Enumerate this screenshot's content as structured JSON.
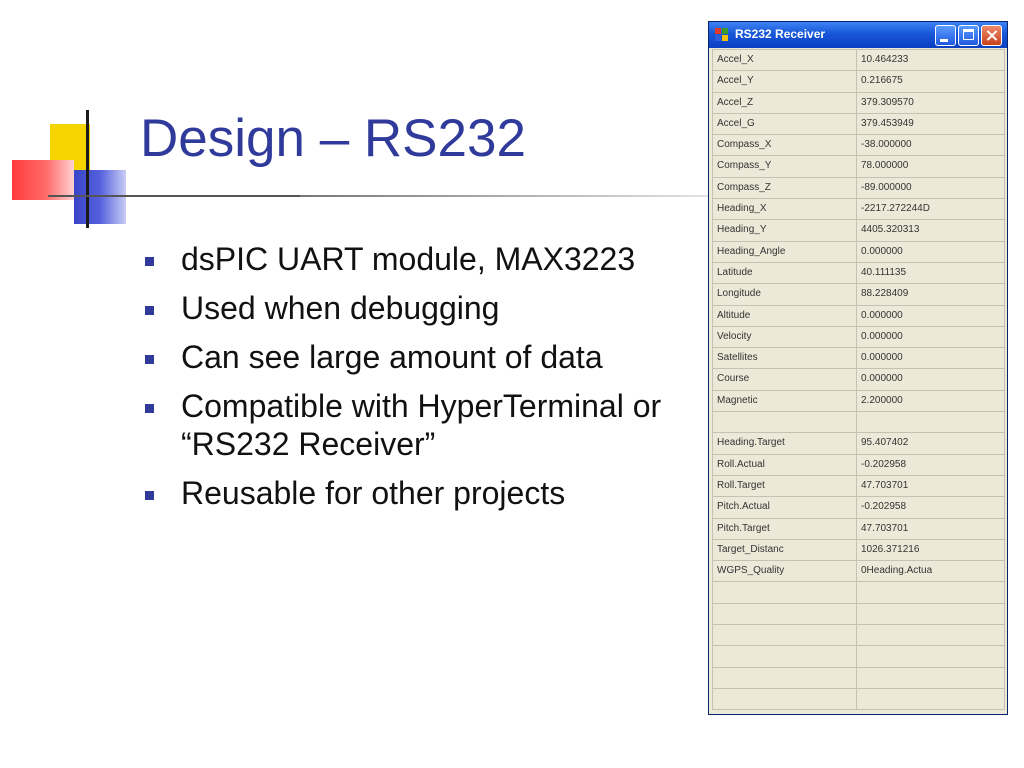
{
  "slide": {
    "title": "Design – RS232",
    "bullets": [
      "dsPIC UART module, MAX3223",
      "Used when debugging",
      "Can see large amount of data",
      "Compatible with HyperTerminal or “RS232 Receiver”",
      "Reusable for other projects"
    ]
  },
  "window": {
    "title": "RS232 Receiver",
    "rows": [
      {
        "key": "Accel_X",
        "value": "10.464233"
      },
      {
        "key": "Accel_Y",
        "value": "0.216675"
      },
      {
        "key": "Accel_Z",
        "value": "379.309570"
      },
      {
        "key": "Accel_G",
        "value": "379.453949"
      },
      {
        "key": "Compass_X",
        "value": "-38.000000"
      },
      {
        "key": "Compass_Y",
        "value": "78.000000"
      },
      {
        "key": "Compass_Z",
        "value": "-89.000000"
      },
      {
        "key": "Heading_X",
        "value": "-2217.272244D"
      },
      {
        "key": "Heading_Y",
        "value": "4405.320313"
      },
      {
        "key": "Heading_Angle",
        "value": "0.000000"
      },
      {
        "key": "Latitude",
        "value": "40.111135"
      },
      {
        "key": "Longitude",
        "value": "88.228409"
      },
      {
        "key": "Altitude",
        "value": "0.000000"
      },
      {
        "key": "Velocity",
        "value": "0.000000"
      },
      {
        "key": "Satellites",
        "value": "0.000000"
      },
      {
        "key": "Course",
        "value": "0.000000"
      },
      {
        "key": "Magnetic",
        "value": "2.200000"
      },
      {
        "key": "",
        "value": ""
      },
      {
        "key": "Heading.Target",
        "value": "95.407402"
      },
      {
        "key": "Roll.Actual",
        "value": "-0.202958"
      },
      {
        "key": "Roll.Target",
        "value": "47.703701"
      },
      {
        "key": "Pitch.Actual",
        "value": "-0.202958"
      },
      {
        "key": "Pitch.Target",
        "value": "47.703701"
      },
      {
        "key": "Target_Distanc",
        "value": "1026.371216"
      },
      {
        "key": "WGPS_Quality",
        "value": "0Heading.Actua"
      },
      {
        "key": "",
        "value": ""
      },
      {
        "key": "",
        "value": ""
      },
      {
        "key": "",
        "value": ""
      },
      {
        "key": "",
        "value": ""
      },
      {
        "key": "",
        "value": ""
      },
      {
        "key": "",
        "value": ""
      }
    ]
  },
  "colors": {
    "title": "#2f3a9b",
    "bullet": "#2f3a9b",
    "window_body": "#ece9d8",
    "titlebar": "#1757d8"
  }
}
